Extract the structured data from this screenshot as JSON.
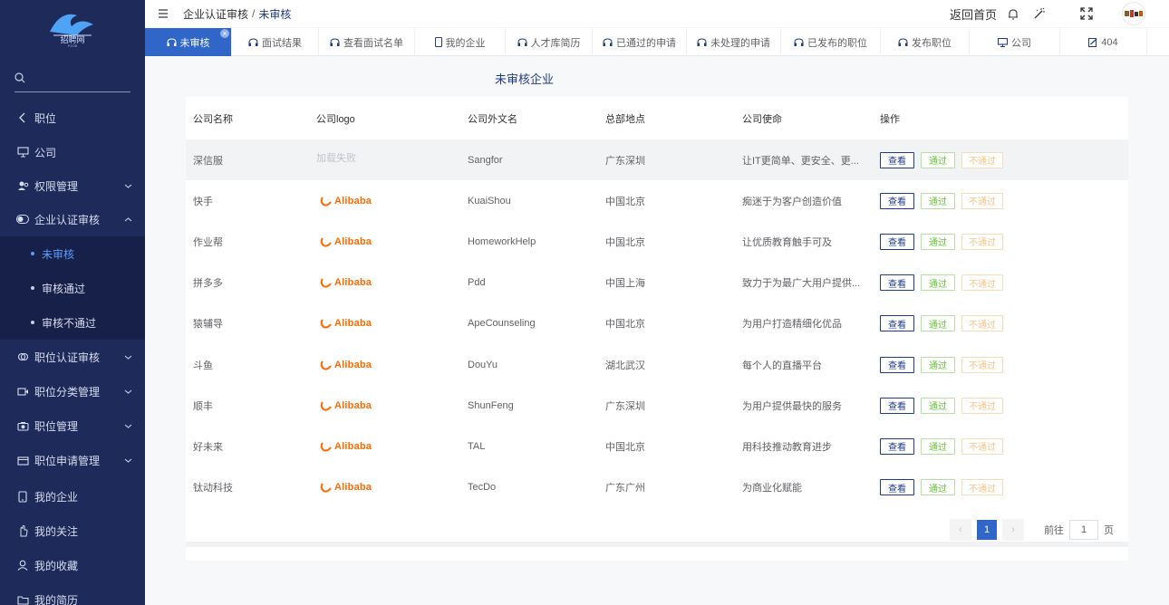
{
  "app": {
    "logo_text": "招聘网",
    "logo_sub": "PJOB"
  },
  "sidebar": {
    "items": [
      {
        "label": "职位",
        "icon": "chevron-left-icon"
      },
      {
        "label": "公司",
        "icon": "monitor-icon"
      },
      {
        "label": "权限管理",
        "icon": "user-group-icon",
        "expandable": true
      },
      {
        "label": "企业认证审核",
        "icon": "toggle-icon",
        "expandable": true,
        "expanded": true
      },
      {
        "label": "职位认证审核",
        "icon": "link-icon",
        "expandable": true
      },
      {
        "label": "职位分类管理",
        "icon": "video-icon",
        "expandable": true
      },
      {
        "label": "职位管理",
        "icon": "camera-icon",
        "expandable": true
      },
      {
        "label": "职位申请管理",
        "icon": "wallet-icon",
        "expandable": true
      },
      {
        "label": "我的企业",
        "icon": "phone-icon"
      },
      {
        "label": "我的关注",
        "icon": "hand-icon"
      },
      {
        "label": "我的收藏",
        "icon": "person-icon"
      },
      {
        "label": "我的简历",
        "icon": "folder-icon"
      }
    ],
    "sub_items": [
      {
        "label": "未审核",
        "active": true
      },
      {
        "label": "审核通过"
      },
      {
        "label": "审核不通过"
      }
    ]
  },
  "header": {
    "breadcrumb": [
      "企业认证审核",
      "未审核"
    ],
    "back_home": "返回首页"
  },
  "tabs": [
    {
      "label": "未审核",
      "active": true
    },
    {
      "label": "面试结果"
    },
    {
      "label": "查看面试名单"
    },
    {
      "label": "我的企业"
    },
    {
      "label": "人才库简历"
    },
    {
      "label": "已通过的申请"
    },
    {
      "label": "未处理的申请"
    },
    {
      "label": "已发布的职位"
    },
    {
      "label": "发布职位"
    },
    {
      "label": "公司"
    },
    {
      "label": "404"
    }
  ],
  "content": {
    "title": "未审核企业",
    "columns": [
      "公司名称",
      "公司logo",
      "公司外文名",
      "总部地点",
      "公司使命",
      "操作"
    ],
    "rows": [
      {
        "name": "深信服",
        "logo": "加载失败",
        "en": "Sangfor",
        "location": "广东深圳",
        "mission": "让IT更简单、更安全、更..."
      },
      {
        "name": "快手",
        "logo": "Alibaba",
        "en": "KuaiShou",
        "location": "中国北京",
        "mission": "痴迷于为客户创造价值"
      },
      {
        "name": "作业帮",
        "logo": "Alibaba",
        "en": "HomeworkHelp",
        "location": "中国北京",
        "mission": "让优质教育触手可及"
      },
      {
        "name": "拼多多",
        "logo": "Alibaba",
        "en": "Pdd",
        "location": "中国上海",
        "mission": "致力于为最广大用户提供..."
      },
      {
        "name": "猿辅导",
        "logo": "Alibaba",
        "en": "ApeCounseling",
        "location": "中国北京",
        "mission": "为用户打造精细化优品"
      },
      {
        "name": "斗鱼",
        "logo": "Alibaba",
        "en": "DouYu",
        "location": "湖北武汉",
        "mission": "每个人的直播平台"
      },
      {
        "name": "顺丰",
        "logo": "Alibaba",
        "en": "ShunFeng",
        "location": "广东深圳",
        "mission": "为用户提供最快的服务"
      },
      {
        "name": "好未来",
        "logo": "Alibaba",
        "en": "TAL",
        "location": "中国北京",
        "mission": "用科技推动教育进步"
      },
      {
        "name": "钛动科技",
        "logo": "Alibaba",
        "en": "TecDo",
        "location": "广东广州",
        "mission": "为商业化赋能"
      }
    ],
    "actions": {
      "view": "查看",
      "pass": "通过",
      "fail": "不通过"
    }
  },
  "pagination": {
    "current_page": "1",
    "goto_prefix": "前往",
    "goto_value": "1",
    "goto_suffix": "页"
  },
  "colors": {
    "sidebar_bg": "#1e2a5a",
    "accent": "#2f66c7",
    "active_sub": "#5b9bff",
    "pass": "#67c23a",
    "fail": "#f3c48a"
  }
}
